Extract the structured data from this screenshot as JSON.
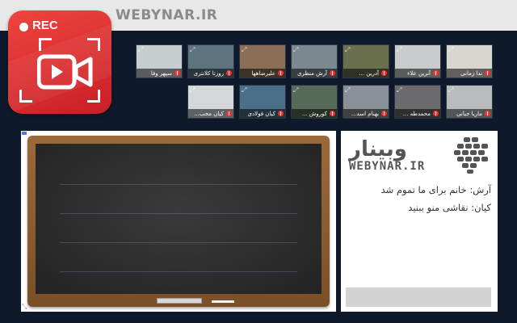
{
  "header": {
    "brand": "WEBYNAR.IR"
  },
  "recorder": {
    "label": "REC",
    "accent": "#e53935"
  },
  "participants_row1": [
    {
      "name": "سپهر وفا",
      "bg": "#c8cdd0"
    },
    {
      "name": "روزتا کلانتری",
      "bg": "#5d7480"
    },
    {
      "name": "علیرضاهها",
      "bg": "#8a6e55"
    },
    {
      "name": "آرش منظری",
      "bg": "#7a8890"
    },
    {
      "name": "آدرین ...",
      "bg": "#6a6f4e"
    },
    {
      "name": "آنرین علاء",
      "bg": "#c9cccc"
    },
    {
      "name": "ندا زمانی",
      "bg": "#d9d6d2"
    }
  ],
  "participants_row2": [
    {
      "name": "کیان محب...",
      "bg": "#d5d8da"
    },
    {
      "name": "کیان فولادی",
      "bg": "#4a6f88"
    },
    {
      "name": "کوروش ...",
      "bg": "#566a58"
    },
    {
      "name": "بهنام اسد...",
      "bg": "#8a9098"
    },
    {
      "name": "محمدطه ...",
      "bg": "#6b6a6e"
    },
    {
      "name": "ماریا جیانی",
      "bg": "#b9bcbf"
    }
  ],
  "logo": {
    "fa": "وبینار",
    "en": "WEBYNAR.IR"
  },
  "chat": {
    "messages": [
      {
        "text": "آرش: خانم برای ما تموم شد"
      },
      {
        "text": "کیان: نقاشی منو ببنید"
      }
    ],
    "input_placeholder": ""
  }
}
